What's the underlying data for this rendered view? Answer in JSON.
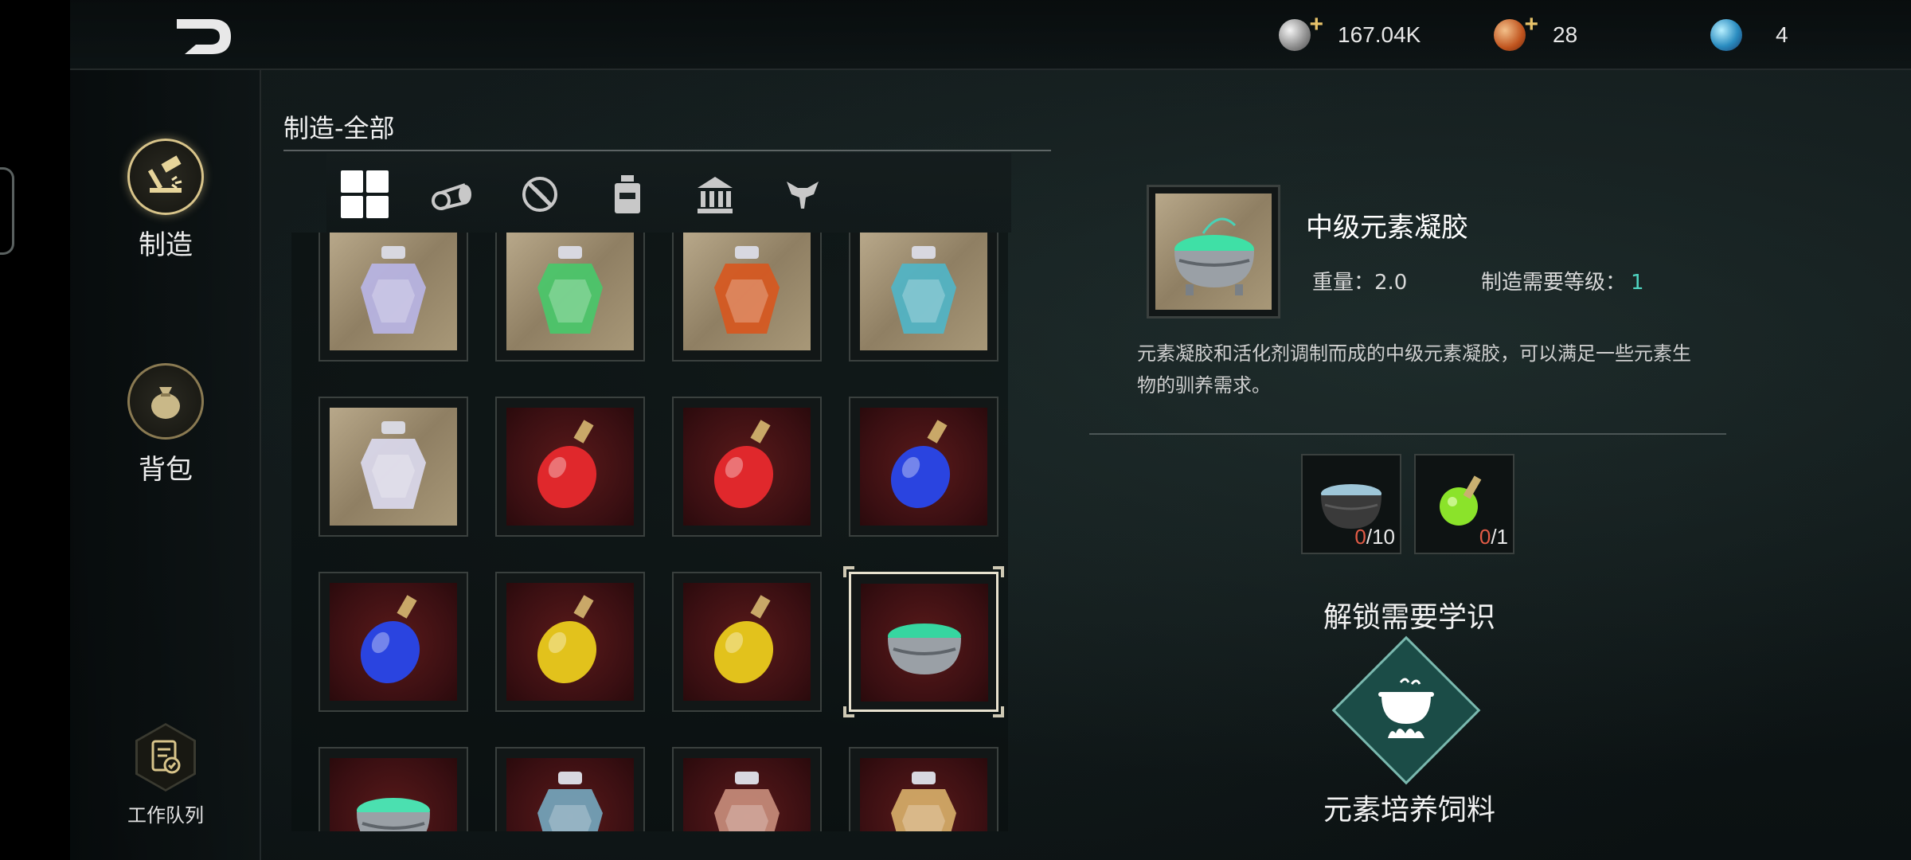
{
  "currencies": [
    {
      "icon": "silver-coin-icon",
      "value": "167.04K",
      "has_plus": true
    },
    {
      "icon": "gold-coin-icon",
      "value": "28",
      "has_plus": true
    },
    {
      "icon": "blue-orb-icon",
      "value": "4",
      "has_plus": false
    }
  ],
  "sidenav": {
    "craft_label": "制造",
    "backpack_label": "背包",
    "queue_label": "工作队列"
  },
  "section_title": "制造-全部",
  "category_tabs": [
    {
      "icon": "all-grid-icon",
      "active": true
    },
    {
      "icon": "materials-logs-icon",
      "active": false
    },
    {
      "icon": "equipment-no-icon",
      "active": false
    },
    {
      "icon": "potion-bottle-icon",
      "active": false
    },
    {
      "icon": "building-icon",
      "active": false
    },
    {
      "icon": "creature-icon",
      "active": false
    }
  ],
  "grid_items": [
    {
      "bg": "parch",
      "icon": "silver-bottle-icon",
      "color": "#b9b6e8"
    },
    {
      "bg": "parch",
      "icon": "green-crown-bottle-icon",
      "color": "#47c96a"
    },
    {
      "bg": "parch",
      "icon": "red-jar-icon",
      "color": "#d8561e"
    },
    {
      "bg": "parch",
      "icon": "teal-crown-bottle-icon",
      "color": "#4fb6c9"
    },
    {
      "bg": "parch",
      "icon": "white-skull-bottle-icon",
      "color": "#dcdaf0"
    },
    {
      "bg": "red",
      "icon": "red-potion-icon",
      "color": "#e0282c"
    },
    {
      "bg": "red",
      "icon": "red-potion-icon",
      "color": "#e0282c"
    },
    {
      "bg": "red",
      "icon": "blue-potion-icon",
      "color": "#2a44e0"
    },
    {
      "bg": "red",
      "icon": "blue-potion-icon",
      "color": "#2a44e0"
    },
    {
      "bg": "red",
      "icon": "yellow-potion-icon",
      "color": "#e2c21c"
    },
    {
      "bg": "red",
      "icon": "yellow-potion-icon",
      "color": "#e2c21c"
    },
    {
      "bg": "red",
      "icon": "green-gel-cauldron-icon",
      "color": "#36d6a0",
      "selected": true
    },
    {
      "bg": "red",
      "icon": "green-gel-pot-icon",
      "color": "#4be0b0"
    },
    {
      "bg": "red",
      "icon": "blue-jar-icon",
      "color": "#76a8c0"
    },
    {
      "bg": "red",
      "icon": "pink-jar-icon",
      "color": "#c98e7c"
    },
    {
      "bg": "red",
      "icon": "amber-jar-icon",
      "color": "#d9b06a"
    }
  ],
  "detail": {
    "name": "中级元素凝胶",
    "weight_label": "重量：2.0",
    "level_label": "制造需要等级：",
    "level_value": "1",
    "description": "元素凝胶和活化剂调制而成的中级元素凝胶，可以满足一些元素生物的驯养需求。"
  },
  "materials": [
    {
      "icon": "elemental-gel-icon",
      "have": "0",
      "need": "/10"
    },
    {
      "icon": "activator-potion-icon",
      "have": "0",
      "need": "/1"
    }
  ],
  "unlock": {
    "title": "解锁需要学识",
    "icon": "cauldron-fire-icon",
    "name": "元素培养饲料"
  },
  "colors": {
    "accent_gold": "#d8c48a",
    "level_teal": "#4fd3c0",
    "insufficient_red": "#e25b46"
  }
}
